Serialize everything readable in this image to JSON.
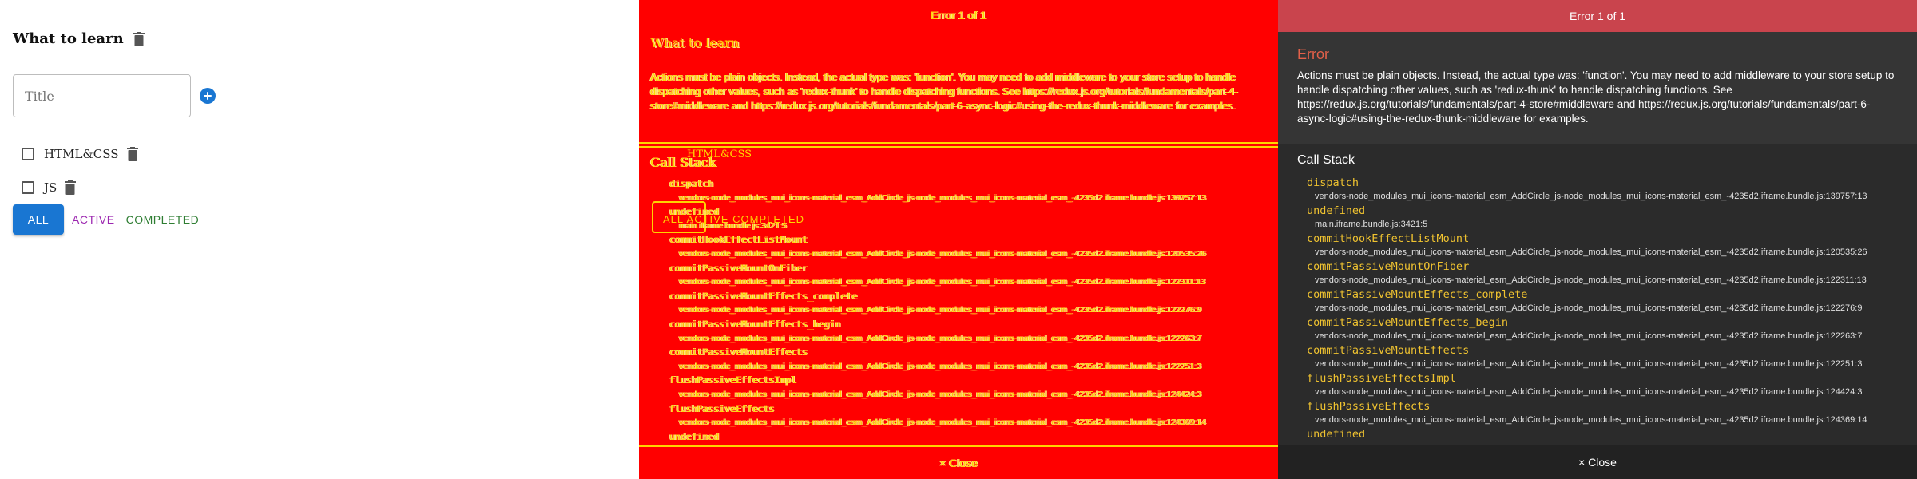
{
  "todo": {
    "heading": "What to learn",
    "title_placeholder": "Title",
    "items": [
      {
        "label": "HTML&CSS",
        "checked": false
      },
      {
        "label": "JS",
        "checked": false
      }
    ],
    "filters": {
      "all": "ALL",
      "active": "ACTIVE",
      "completed": "COMPLETED"
    },
    "colors": {
      "primary": "#1976d2",
      "secondary": "#9c27b0",
      "success": "#2e7d32"
    }
  },
  "glitch_overlay": {
    "header": "Error 1 of 1",
    "heading": "What to learn",
    "callstack_title": "Call Stack",
    "item_label": "HTML&CSS",
    "filters_text": "ALL ACTIVE COMPLETED",
    "close": "× Close",
    "colors": {
      "background": "#ff0000",
      "text": "#ffd400"
    }
  },
  "error_overlay": {
    "header": "Error 1 of 1",
    "title": "Error",
    "message": "Actions must be plain objects. Instead, the actual type was: 'function'. You may need to add middleware to your store setup to handle dispatching other values, such as 'redux-thunk' to handle dispatching functions. See https://redux.js.org/tutorials/fundamentals/part-4-store#middleware and https://redux.js.org/tutorials/fundamentals/part-6-async-logic#using-the-redux-thunk-middleware for examples.",
    "callstack_title": "Call Stack",
    "frames": [
      {
        "fn": "dispatch",
        "loc": "vendors-node_modules_mui_icons-material_esm_AddCircle_js-node_modules_mui_icons-material_esm_-4235d2.iframe.bundle.js:139757:13"
      },
      {
        "fn": "undefined",
        "loc": "main.iframe.bundle.js:3421:5"
      },
      {
        "fn": "commitHookEffectListMount",
        "loc": "vendors-node_modules_mui_icons-material_esm_AddCircle_js-node_modules_mui_icons-material_esm_-4235d2.iframe.bundle.js:120535:26"
      },
      {
        "fn": "commitPassiveMountOnFiber",
        "loc": "vendors-node_modules_mui_icons-material_esm_AddCircle_js-node_modules_mui_icons-material_esm_-4235d2.iframe.bundle.js:122311:13"
      },
      {
        "fn": "commitPassiveMountEffects_complete",
        "loc": "vendors-node_modules_mui_icons-material_esm_AddCircle_js-node_modules_mui_icons-material_esm_-4235d2.iframe.bundle.js:122276:9"
      },
      {
        "fn": "commitPassiveMountEffects_begin",
        "loc": "vendors-node_modules_mui_icons-material_esm_AddCircle_js-node_modules_mui_icons-material_esm_-4235d2.iframe.bundle.js:122263:7"
      },
      {
        "fn": "commitPassiveMountEffects",
        "loc": "vendors-node_modules_mui_icons-material_esm_AddCircle_js-node_modules_mui_icons-material_esm_-4235d2.iframe.bundle.js:122251:3"
      },
      {
        "fn": "flushPassiveEffectsImpl",
        "loc": "vendors-node_modules_mui_icons-material_esm_AddCircle_js-node_modules_mui_icons-material_esm_-4235d2.iframe.bundle.js:124424:3"
      },
      {
        "fn": "flushPassiveEffects",
        "loc": "vendors-node_modules_mui_icons-material_esm_AddCircle_js-node_modules_mui_icons-material_esm_-4235d2.iframe.bundle.js:124369:14"
      },
      {
        "fn": "undefined",
        "loc": ""
      }
    ],
    "close": "× Close",
    "colors": {
      "header": "#c9444d",
      "title": "#e36049",
      "function_name": "#f0c330",
      "background": "#353535"
    }
  }
}
